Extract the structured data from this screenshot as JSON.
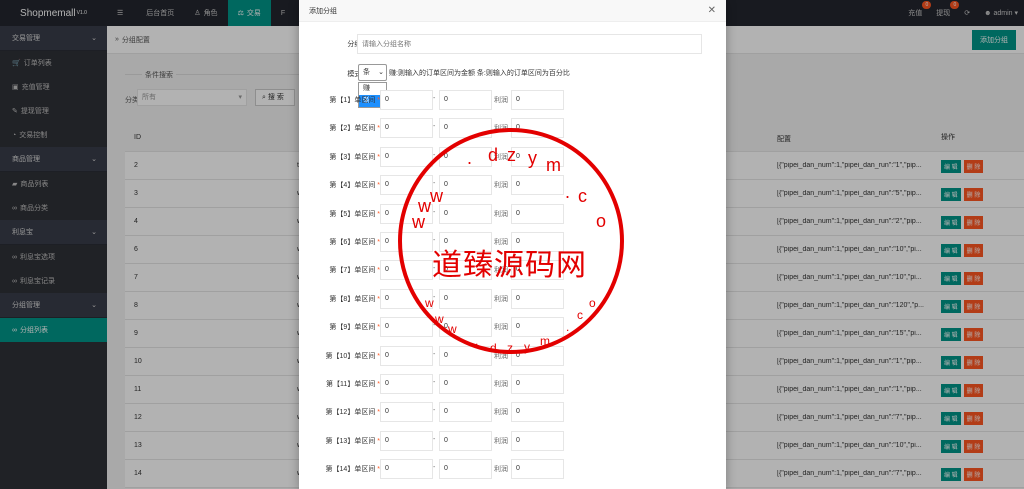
{
  "app": {
    "name": "Shopmemall",
    "version": "V1.0"
  },
  "topnav": [
    {
      "icon": "menu-icon",
      "label": ""
    },
    {
      "icon": "",
      "label": "后台首页"
    },
    {
      "icon": "user-icon",
      "label": "角色"
    },
    {
      "icon": "scale-icon",
      "label": "交易"
    },
    {
      "icon": "",
      "label": "F"
    }
  ],
  "topright": {
    "recharge": "充值",
    "recharge_count": "0",
    "withdraw": "提现",
    "withdraw_count": "0",
    "user": "admin"
  },
  "sidebar": [
    {
      "type": "group",
      "label": "交易管理"
    },
    {
      "type": "item",
      "icon": "cart-icon",
      "label": "订单列表"
    },
    {
      "type": "item",
      "icon": "wallet-icon",
      "label": "充值管理"
    },
    {
      "type": "item",
      "icon": "hammer-icon",
      "label": "提现管理"
    },
    {
      "type": "item",
      "icon": "gauge-icon",
      "label": "交易控制"
    },
    {
      "type": "group",
      "label": "商品管理"
    },
    {
      "type": "item",
      "icon": "truck-icon",
      "label": "商品列表"
    },
    {
      "type": "item",
      "icon": "link-icon",
      "label": "商品分类"
    },
    {
      "type": "group",
      "label": "利息宝"
    },
    {
      "type": "item",
      "icon": "link-icon",
      "label": "利息宝选项"
    },
    {
      "type": "item",
      "icon": "link-icon",
      "label": "利息宝记录"
    },
    {
      "type": "group",
      "label": "分组管理"
    },
    {
      "type": "item",
      "icon": "link-icon",
      "label": "分组列表",
      "active": true
    }
  ],
  "main": {
    "breadcrumb": "分组配置",
    "add_button": "添加分组",
    "filter": {
      "legend": "条件搜索",
      "label": "分类",
      "select_value": "所有",
      "search_button": "搜 索"
    },
    "table": {
      "headers": [
        "ID",
        "",
        "配置",
        "操作"
      ],
      "rows": [
        {
          "id": "2",
          "name": "t",
          "config": "[{\"pipei_dan_num\":1,\"pipei_dan_run\":\"1\",\"pip..."
        },
        {
          "id": "3",
          "name": "w",
          "config": "[{\"pipei_dan_num\":1,\"pipei_dan_run\":\"5\",\"pip..."
        },
        {
          "id": "4",
          "name": "w",
          "config": "[{\"pipei_dan_num\":1,\"pipei_dan_run\":\"2\",\"pip..."
        },
        {
          "id": "6",
          "name": "w",
          "config": "[{\"pipei_dan_num\":1,\"pipei_dan_run\":\"10\",\"pi..."
        },
        {
          "id": "7",
          "name": "w",
          "config": "[{\"pipei_dan_num\":1,\"pipei_dan_run\":\"10\",\"pi..."
        },
        {
          "id": "8",
          "name": "w",
          "config": "[{\"pipei_dan_num\":1,\"pipei_dan_run\":\"120\",\"p..."
        },
        {
          "id": "9",
          "name": "w",
          "config": "[{\"pipei_dan_num\":1,\"pipei_dan_run\":\"15\",\"pi..."
        },
        {
          "id": "10",
          "name": "w",
          "config": "[{\"pipei_dan_num\":1,\"pipei_dan_run\":\"1\",\"pip..."
        },
        {
          "id": "11",
          "name": "w",
          "config": "[{\"pipei_dan_num\":1,\"pipei_dan_run\":\"1\",\"pip..."
        },
        {
          "id": "12",
          "name": "w",
          "config": "[{\"pipei_dan_num\":1,\"pipei_dan_run\":\"7\",\"pip..."
        },
        {
          "id": "13",
          "name": "w",
          "config": "[{\"pipei_dan_num\":1,\"pipei_dan_run\":\"10\",\"pi..."
        },
        {
          "id": "14",
          "name": "w",
          "config": "[{\"pipei_dan_num\":1,\"pipei_dan_run\":\"7\",\"pip..."
        }
      ],
      "edit_label": "编 辑",
      "delete_label": "删 除"
    }
  },
  "modal": {
    "title": "添加分组",
    "name_label": "分组名称",
    "name_placeholder": "请输入分组名称",
    "mode_label": "模式选项",
    "mode_value": "条",
    "mode_hint": "赚:则输入的订单区间为金额 条:则输入的订单区间为百分比",
    "mode_options": [
      "赚",
      "条"
    ],
    "ranges": [
      {
        "label": "第【1】单区间",
        "from": "0",
        "to": "0",
        "profit": "0"
      },
      {
        "label": "第【2】单区间",
        "from": "0",
        "to": "0",
        "profit": "0"
      },
      {
        "label": "第【3】单区间",
        "from": "0",
        "to": "0",
        "profit": "0"
      },
      {
        "label": "第【4】单区间",
        "from": "0",
        "to": "0",
        "profit": "0"
      },
      {
        "label": "第【5】单区间",
        "from": "0",
        "to": "0",
        "profit": "0"
      },
      {
        "label": "第【6】单区间",
        "from": "0",
        "to": "0",
        "profit": "0"
      },
      {
        "label": "第【7】单区间",
        "from": "0",
        "to": "0",
        "profit": "0"
      },
      {
        "label": "第【8】单区间",
        "from": "0",
        "to": "0",
        "profit": "0"
      },
      {
        "label": "第【9】单区间",
        "from": "0",
        "to": "0",
        "profit": "0"
      },
      {
        "label": "第【10】单区间",
        "from": "0",
        "to": "0",
        "profit": "0"
      },
      {
        "label": "第【11】单区间",
        "from": "0",
        "to": "0",
        "profit": "0"
      },
      {
        "label": "第【12】单区间",
        "from": "0",
        "to": "0",
        "profit": "0"
      },
      {
        "label": "第【13】单区间",
        "from": "0",
        "to": "0",
        "profit": "0"
      },
      {
        "label": "第【14】单区间",
        "from": "0",
        "to": "0",
        "profit": "0"
      }
    ],
    "profit_label": "利润"
  },
  "stamp": {
    "text": "道臻源码网",
    "site": "www.dzym.com"
  }
}
